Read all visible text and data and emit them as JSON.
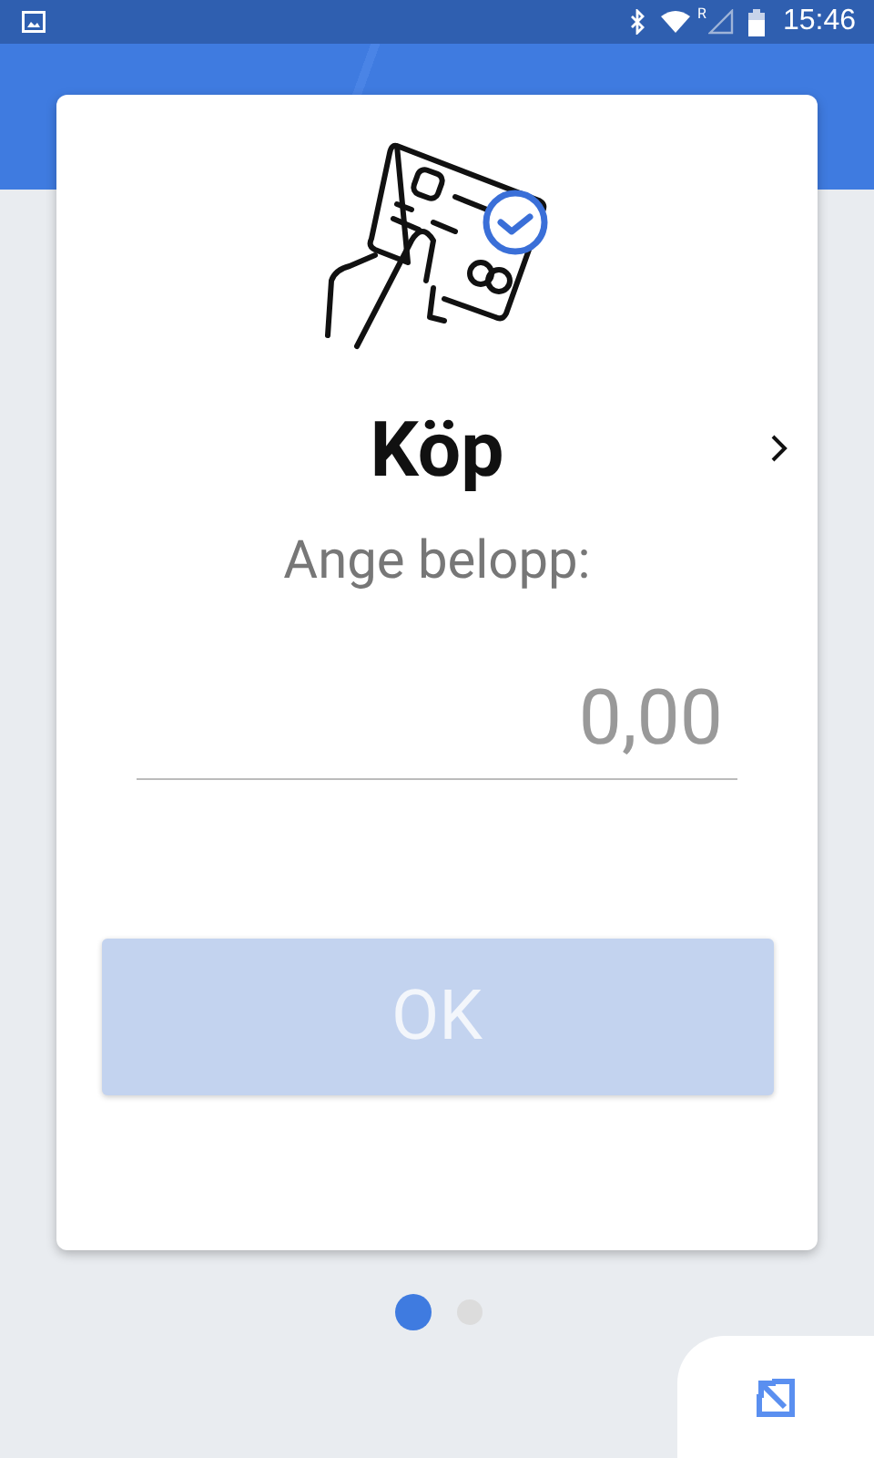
{
  "status_bar": {
    "time": "15:46",
    "roaming_mark": "R"
  },
  "card": {
    "title": "Köp",
    "prompt": "Ange belopp:",
    "amount": {
      "placeholder": "0,00"
    },
    "ok_button": {
      "label": "OK",
      "disabled": true
    }
  },
  "page_dots": [
    {
      "selected": true
    },
    {
      "selected": false
    }
  ]
}
